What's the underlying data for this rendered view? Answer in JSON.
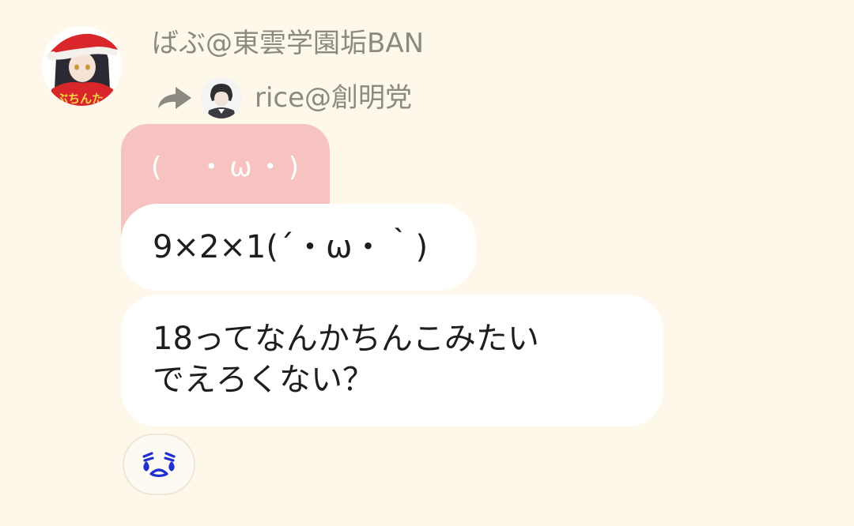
{
  "message": {
    "sender_name": "ばぶ@東雲学園垢BAN",
    "avatar_icon": "santa-anime-girl-avatar-icon",
    "forwarded_from": {
      "icon": "forward-arrow-icon",
      "avatar_icon": "reply-user-avatar-icon",
      "name": "rice@創明党"
    },
    "quoted_text": "(　・ω・)",
    "bubbles": [
      {
        "lines": [
          "9×2×1(´・ω・｀)"
        ]
      },
      {
        "lines": [
          "18ってなんかちんこみたい",
          "でえろくない？"
        ]
      }
    ],
    "reaction": {
      "icon": "crying-face-reaction-icon",
      "color": "#1f2fd0"
    }
  },
  "colors": {
    "background": "#fdf8ea",
    "bubble": "#ffffff",
    "quoted_bubble": "#f6c3c0",
    "meta_text": "#8a8a80"
  }
}
